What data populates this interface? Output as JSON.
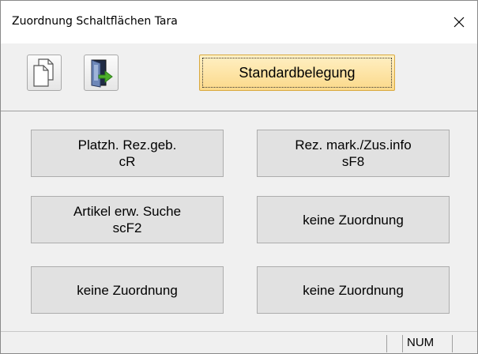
{
  "window": {
    "title": "Zuordnung Schaltflächen Tara"
  },
  "toolbar": {
    "icons": [
      "copy-pages-icon",
      "exit-door-icon"
    ],
    "standard_button": "Standardbelegung"
  },
  "assignments": [
    {
      "line1": "Platzh. Rez.geb.",
      "line2": "cR"
    },
    {
      "line1": "Rez. mark./Zus.info",
      "line2": "sF8"
    },
    {
      "line1": "Artikel erw. Suche",
      "line2": "scF2"
    },
    {
      "line1": "keine Zuordnung",
      "line2": ""
    },
    {
      "line1": "keine Zuordnung",
      "line2": ""
    },
    {
      "line1": "keine Zuordnung",
      "line2": ""
    }
  ],
  "statusbar": {
    "num": "NUM"
  },
  "colors": {
    "standard_button_fill": "#fbd98a",
    "standard_button_border": "#d9a93f",
    "door_arrow": "#4caf2a"
  }
}
